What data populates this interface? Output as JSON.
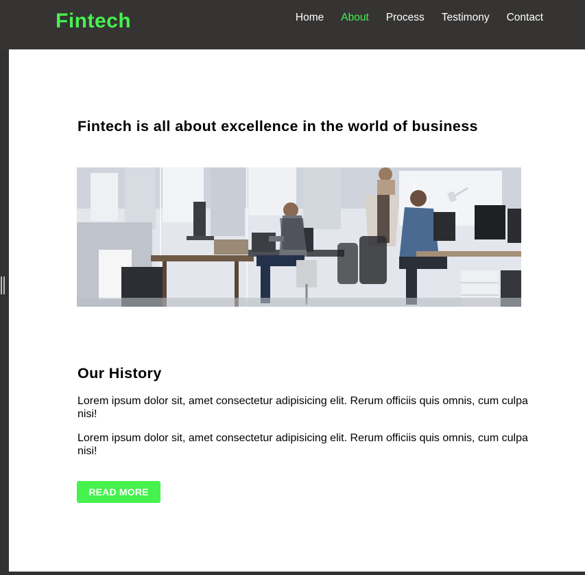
{
  "header": {
    "brand": "Fintech",
    "nav": [
      {
        "label": "Home",
        "active": false
      },
      {
        "label": "About",
        "active": true
      },
      {
        "label": "Process",
        "active": false
      },
      {
        "label": "Testimony",
        "active": false
      },
      {
        "label": "Contact",
        "active": false
      }
    ]
  },
  "about": {
    "headline": "Fintech is all about excellence in the world of business",
    "image": "office-team-photo"
  },
  "history": {
    "title": "Our History",
    "paragraphs": [
      "Lorem ipsum dolor sit, amet consectetur adipisicing elit. Rerum officiis quis omnis, cum culpa nisi!",
      "Lorem ipsum dolor sit, amet consectetur adipisicing elit. Rerum officiis quis omnis, cum culpa nisi!"
    ],
    "button_label": "READ MORE"
  },
  "colors": {
    "accent": "#46f24e",
    "navbar": "#353433",
    "text": "#000000"
  }
}
